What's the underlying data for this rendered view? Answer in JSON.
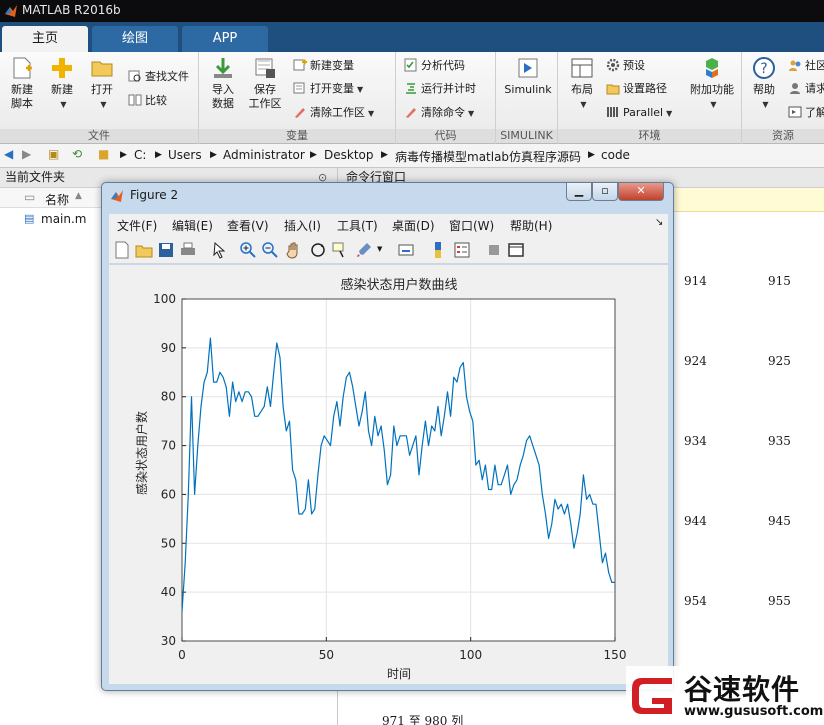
{
  "app": {
    "title": "MATLAB R2016b"
  },
  "tabs": [
    {
      "label": "主页"
    },
    {
      "label": "绘图"
    },
    {
      "label": "APP"
    }
  ],
  "ribbon": {
    "groups": {
      "file": "文件",
      "variable": "变量",
      "code": "代码",
      "simulink": "SIMULINK",
      "env": "环境",
      "resources": "资源"
    },
    "new_script": {
      "line1": "新建",
      "line2": "脚本"
    },
    "new": "新建",
    "open": "打开",
    "find_files": "查找文件",
    "compare": "比较",
    "import": {
      "line1": "导入",
      "line2": "数据"
    },
    "save_ws": {
      "line1": "保存",
      "line2": "工作区"
    },
    "new_var": "新建变量",
    "open_var": "打开变量",
    "clear_ws": "清除工作区",
    "analyze": "分析代码",
    "run_time": "运行并计时",
    "clear_cmd": "清除命令",
    "simulink": "Simulink",
    "layout": "布局",
    "prefs": "预设",
    "set_path": "设置路径",
    "parallel": "Parallel",
    "addons": "附加功能",
    "help": "帮助",
    "community": "社区",
    "request": "请求",
    "learn": "了解"
  },
  "address": {
    "path": [
      "C:",
      "Users",
      "Administrator",
      "Desktop",
      "病毒传播模型matlab仿真程序源码",
      "code"
    ]
  },
  "left_panel": {
    "title": "当前文件夹",
    "col_name": "名称",
    "files": [
      {
        "name": "main.m"
      }
    ]
  },
  "right_panel": {
    "title": "命令行窗口",
    "numbers": [
      [
        "914",
        "915"
      ],
      [
        "924",
        "925"
      ],
      [
        "934",
        "935"
      ],
      [
        "944",
        "945"
      ],
      [
        "954",
        "955"
      ]
    ],
    "footer": "971 至 980 列"
  },
  "figure": {
    "title": "Figure 2",
    "menu": [
      "文件(F)",
      "编辑(E)",
      "查看(V)",
      "插入(I)",
      "工具(T)",
      "桌面(D)",
      "窗口(W)",
      "帮助(H)"
    ]
  },
  "chart_data": {
    "type": "line",
    "title": "感染状态用户数曲线",
    "xlabel": "时间",
    "ylabel": "感染状态用户数",
    "xlim": [
      0,
      150
    ],
    "ylim": [
      30,
      100
    ],
    "xticks": [
      0,
      50,
      100,
      150
    ],
    "yticks": [
      30,
      40,
      50,
      60,
      70,
      80,
      90,
      100
    ],
    "grid": true,
    "color": "#0072bd",
    "series": [
      {
        "values": [
          36,
          46,
          60,
          80,
          60,
          70,
          78,
          83,
          85,
          92,
          83,
          83,
          85,
          84,
          82,
          76,
          83,
          79,
          81,
          79,
          81,
          81,
          80,
          76,
          76,
          77,
          78,
          82,
          78,
          85,
          91,
          88,
          78,
          73,
          75,
          65,
          63,
          56,
          56,
          57,
          63,
          56,
          57,
          64,
          70,
          72,
          71,
          70,
          76,
          79,
          74,
          80,
          84,
          85,
          82,
          78,
          74,
          77,
          81,
          73,
          70,
          76,
          72,
          74,
          69,
          62,
          64,
          74,
          70,
          72,
          72,
          72,
          68,
          70,
          72,
          64,
          70,
          75,
          70,
          74,
          73,
          78,
          72,
          76,
          81,
          76,
          84,
          83,
          86,
          87,
          80,
          77,
          75,
          66,
          67,
          63,
          66,
          61,
          61,
          66,
          62,
          62,
          64,
          66,
          60,
          62,
          63,
          66,
          68,
          71,
          72,
          70,
          68,
          66,
          60,
          56,
          51,
          54,
          59,
          57,
          58,
          56,
          58,
          54,
          49,
          52,
          56,
          64,
          59,
          60,
          58,
          58,
          52,
          46,
          48,
          44,
          42,
          42
        ]
      }
    ]
  },
  "watermark": {
    "text": "谷速软件",
    "url": "www.gususoft.com"
  }
}
